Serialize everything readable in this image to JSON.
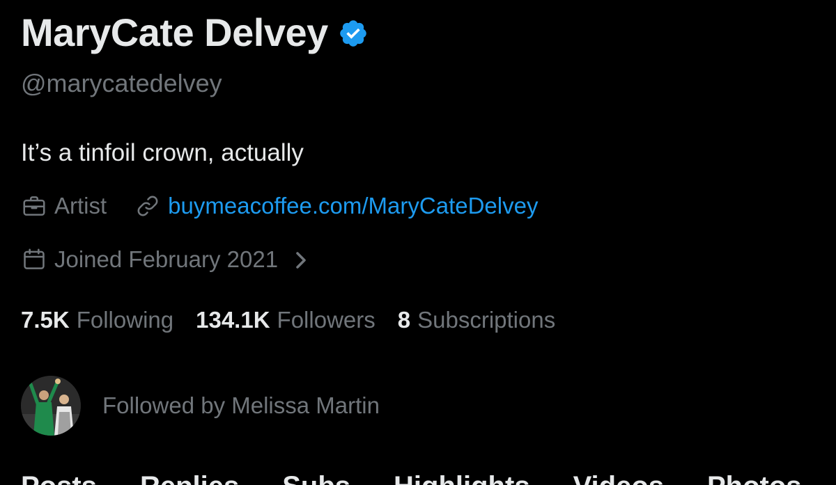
{
  "profile": {
    "display_name": "MaryCate Delvey",
    "verified": true,
    "handle": "@marycatedelvey",
    "bio": "It’s a tinfoil crown, actually",
    "category": "Artist",
    "website": "buymeacoffee.com/MaryCateDelvey",
    "joined": "Joined February 2021"
  },
  "stats": {
    "following_count": "7.5K",
    "following_label": "Following",
    "followers_count": "134.1K",
    "followers_label": "Followers",
    "subscriptions_count": "8",
    "subscriptions_label": "Subscriptions"
  },
  "followed_by": {
    "text": "Followed by Melissa Martin"
  },
  "tabs": [
    "Posts",
    "Replies",
    "Subs",
    "Highlights",
    "Videos",
    "Photos"
  ],
  "icons": {
    "verified": "verified-badge-icon",
    "category": "briefcase-icon",
    "website": "link-icon",
    "joined": "calendar-icon",
    "joined_more": "chevron-right-icon"
  },
  "colors": {
    "background": "#000000",
    "primary_text": "#e7e9ea",
    "secondary_text": "#71767b",
    "link": "#1d9bf0",
    "verified": "#1d9bf0"
  }
}
